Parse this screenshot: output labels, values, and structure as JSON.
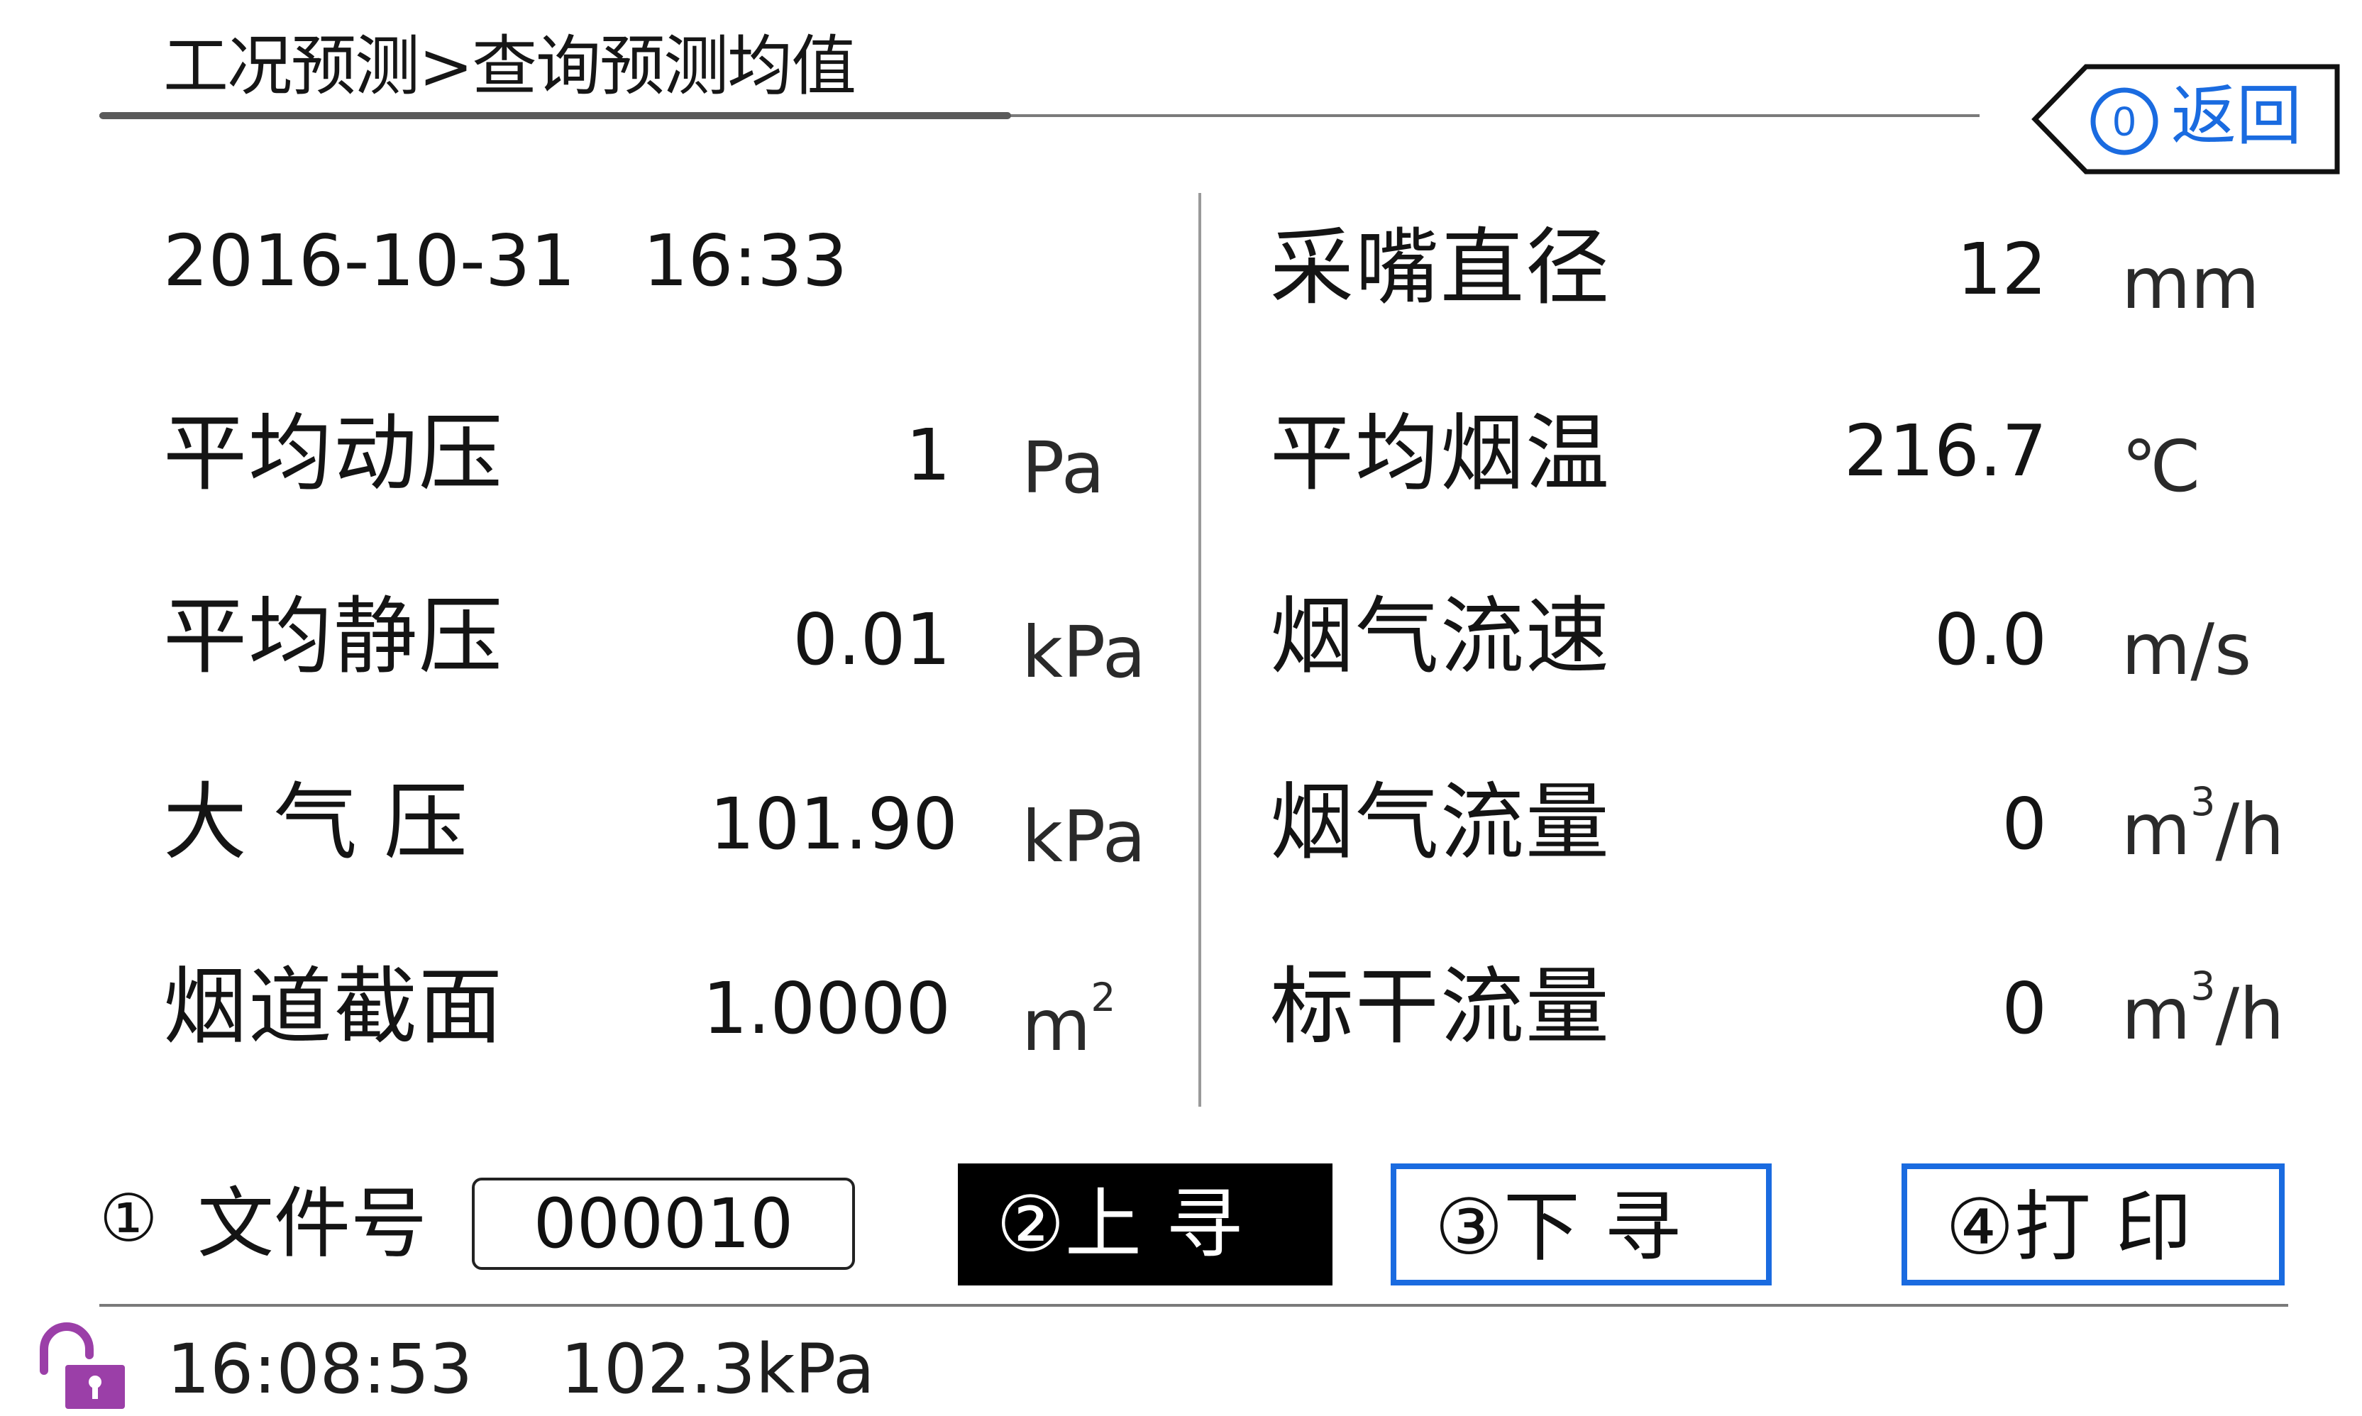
{
  "header": {
    "breadcrumb": "工况预测>查询预测均值",
    "back_button": {
      "key": "0",
      "label": "返回"
    }
  },
  "record": {
    "date": "2016-10-31",
    "time": "16:33"
  },
  "left_fields": [
    {
      "label": "平均动压",
      "value": "1",
      "unit": "Pa"
    },
    {
      "label": "平均静压",
      "value": "0.01",
      "unit": "kPa"
    },
    {
      "label": "大 气 压",
      "value": "101.90",
      "unit": "kPa"
    },
    {
      "label": "烟道截面",
      "value": "1.0000",
      "unit": "m",
      "unit_sup": "2"
    }
  ],
  "right_fields": [
    {
      "label": "采嘴直径",
      "value": "12",
      "unit": "mm"
    },
    {
      "label": "平均烟温",
      "value": "216.7",
      "unit": "℃"
    },
    {
      "label": "烟气流速",
      "value": "0.0",
      "unit": "m/s"
    },
    {
      "label": "烟气流量",
      "value": "0",
      "unit": "m",
      "unit_sup": "3",
      "unit_suffix": "/h"
    },
    {
      "label": "标干流量",
      "value": "0",
      "unit": "m",
      "unit_sup": "3",
      "unit_suffix": "/h"
    }
  ],
  "controls": {
    "file_key": "①",
    "file_label": "文件号",
    "file_value": "000010",
    "prev_button": "②上 寻",
    "next_button": "③下 寻",
    "print_button": "④打 印"
  },
  "status_bar": {
    "lock_icon": "unlocked-padlock-icon",
    "time": "16:08:53",
    "pressure": "102.3kPa"
  },
  "colors": {
    "accent_blue": "#1a6be0",
    "lock_purple": "#9b3fa8",
    "active_button_bg": "#000000"
  }
}
